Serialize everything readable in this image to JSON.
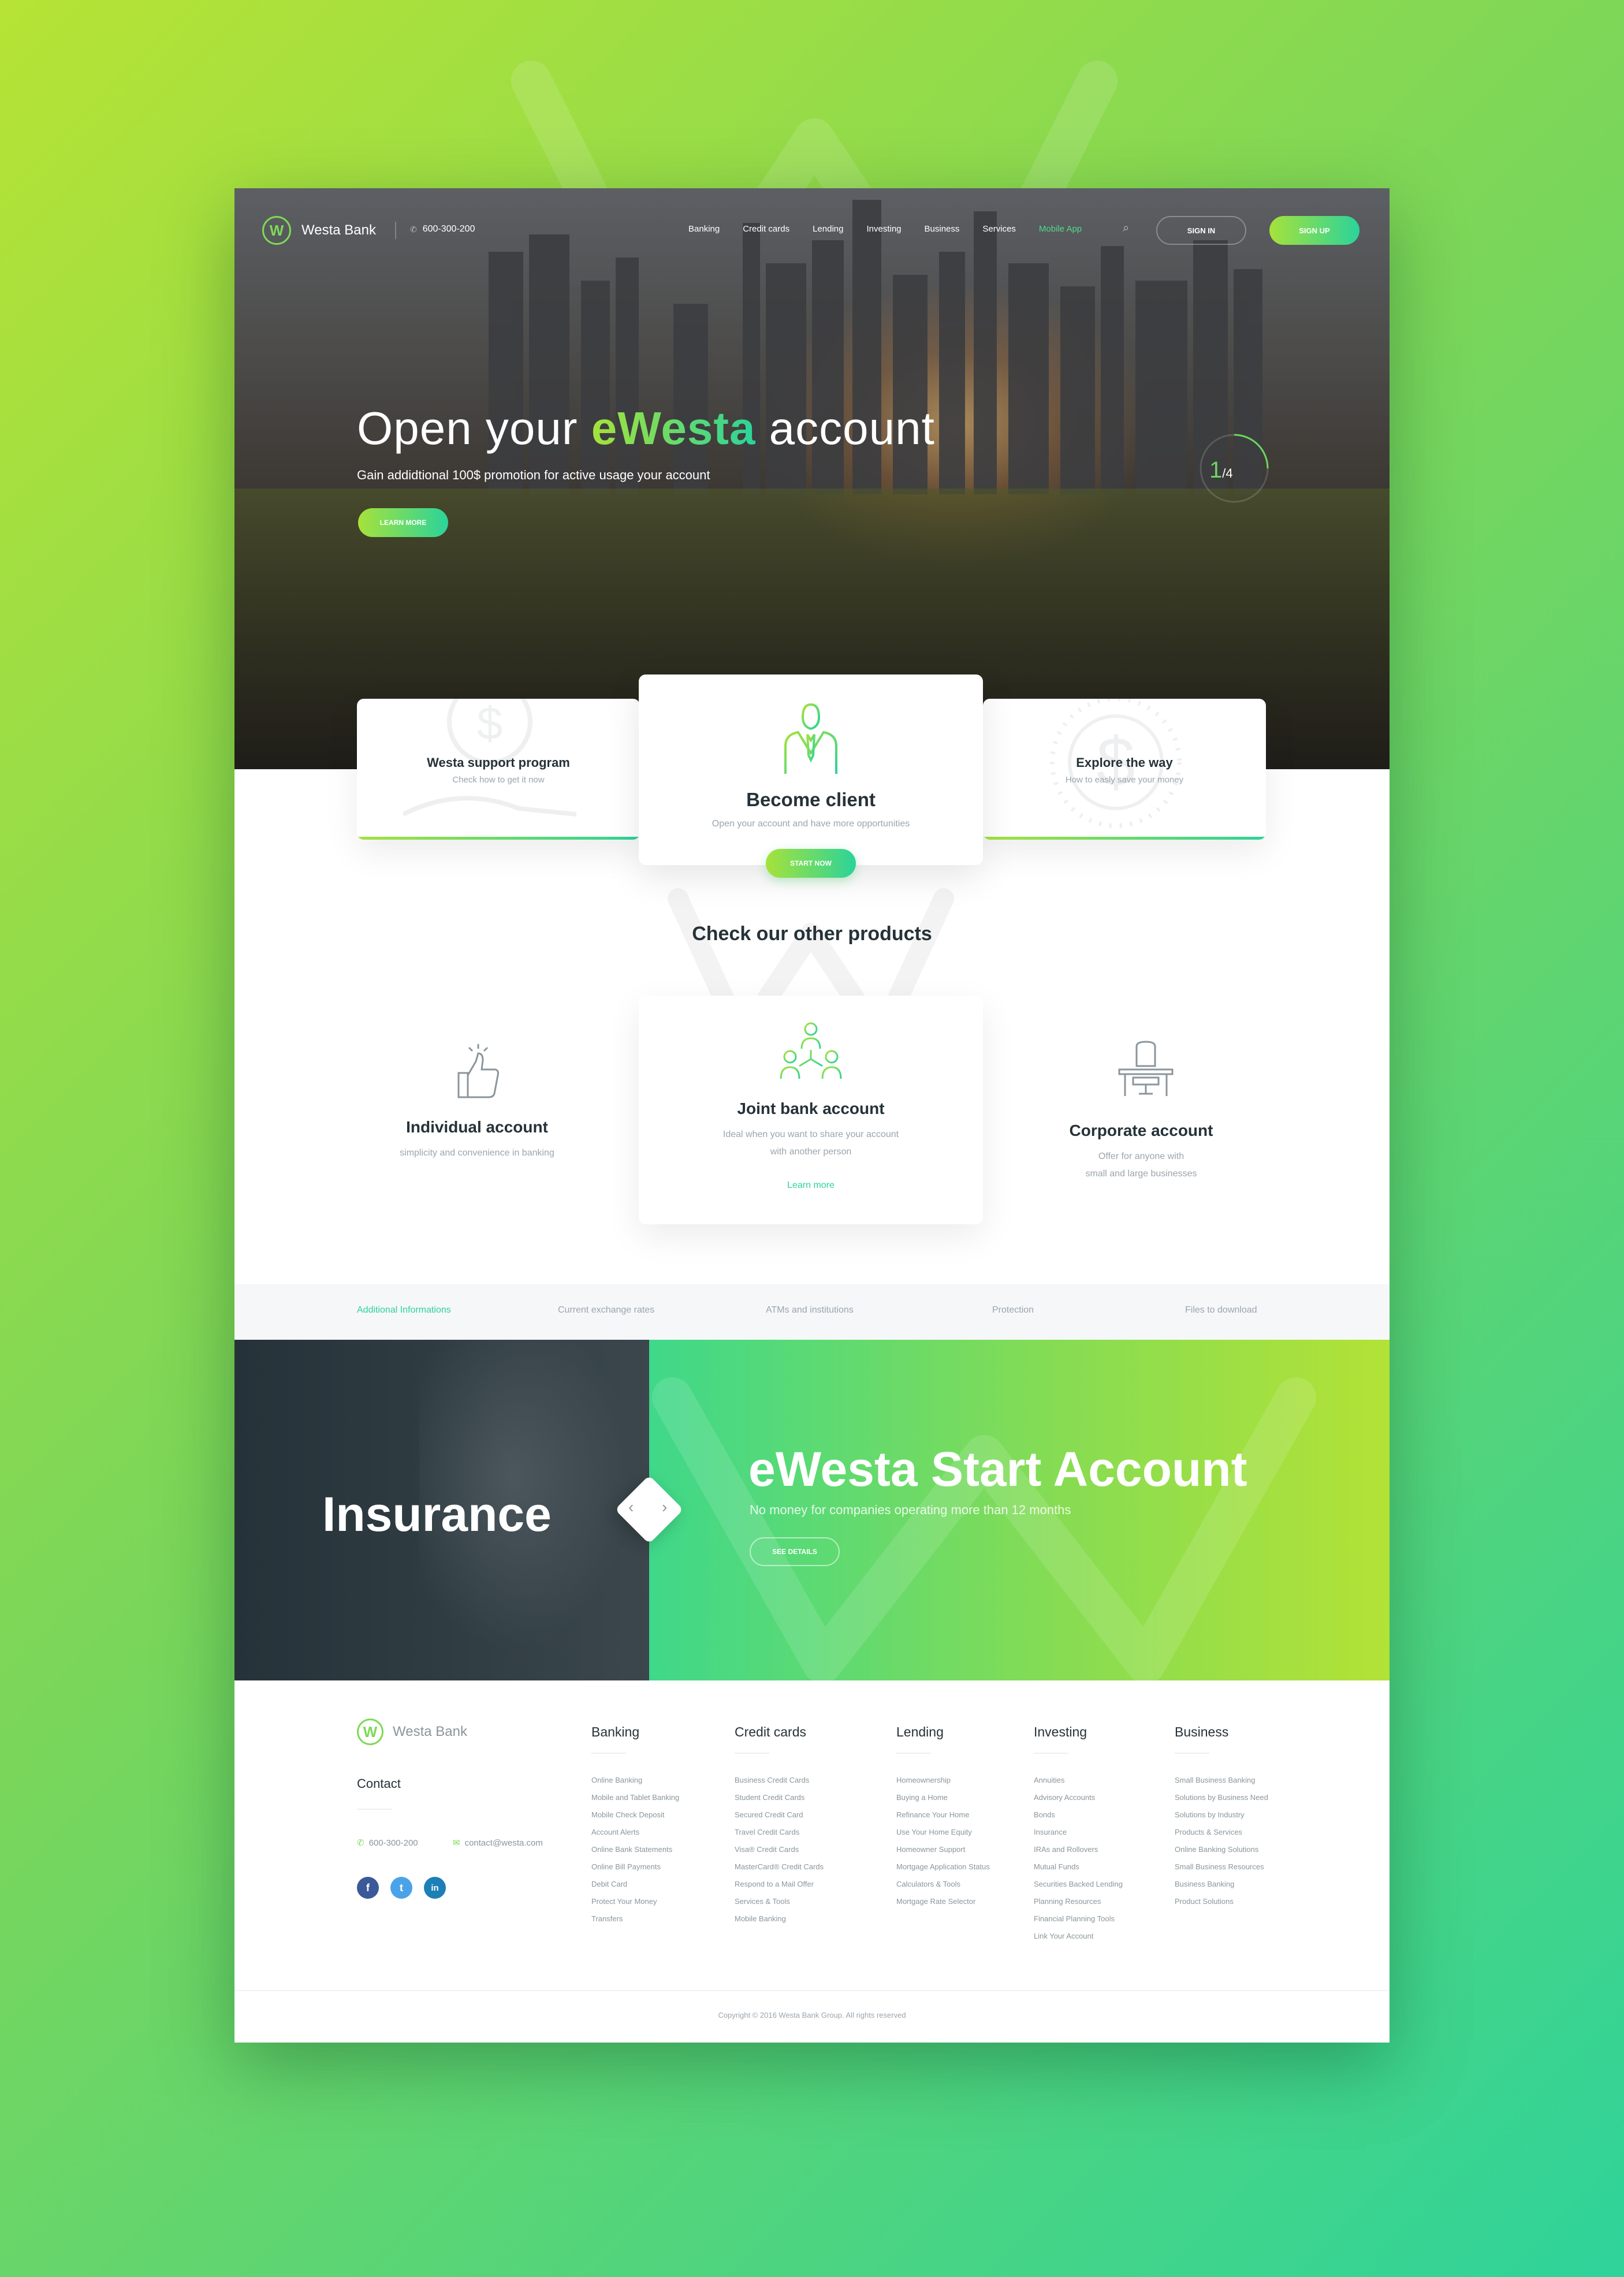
{
  "brand": {
    "name": "Westa Bank",
    "logo_letter": "W",
    "accent": "#2bd39a",
    "accent2": "#a6e23b"
  },
  "header": {
    "phone": "600-300-200",
    "menu": [
      "Banking",
      "Credit cards",
      "Lending",
      "Investing",
      "Business",
      "Services",
      "Mobile App"
    ],
    "active_menu": "Mobile App",
    "signin_label": "SIGN IN",
    "signup_label": "SIGN UP"
  },
  "hero": {
    "title_pre": "Open your ",
    "title_accent": "eWesta",
    "title_post": " account",
    "subtitle": "Gain addidtional 100$ promotion for active usage your account",
    "button_label": "LEARN MORE",
    "slide_current": "1",
    "slide_total": "/4",
    "slide_progress": 0.25
  },
  "features": {
    "left": {
      "title": "Westa support program",
      "subtitle": "Check how to get it now"
    },
    "center": {
      "title": "Become client",
      "subtitle": "Open your account and have more opportunities",
      "button_label": "START NOW"
    },
    "right": {
      "title": "Explore the way",
      "subtitle": "How to easly save your money"
    }
  },
  "products": {
    "title": "Check our other products",
    "left": {
      "title": "Individual account",
      "subtitle": "simplicity and convenience in banking"
    },
    "center": {
      "title": "Joint bank account",
      "subtitle_line1": "Ideal when you want to share your account",
      "subtitle_line2": "with another person",
      "link": "Learn more"
    },
    "right": {
      "title": "Corporate account",
      "subtitle_line1": "Offer for anyone with",
      "subtitle_line2": "small and large businesses"
    }
  },
  "tabs": [
    "Additional Informations",
    "Current exchange rates",
    "ATMs and institutions",
    "Protection",
    "Files to download"
  ],
  "insurance": {
    "title": "Insurance"
  },
  "promo": {
    "title": "eWesta Start Account",
    "subtitle": "No money for companies operating more than 12 months",
    "button_label": "SEE DETAILS"
  },
  "footer": {
    "brand": "Westa Bank",
    "contact_title": "Contact",
    "phone": "600-300-200",
    "email": "contact@westa.com",
    "social": [
      "f",
      "t",
      "in"
    ],
    "columns": [
      {
        "title": "Banking",
        "items": [
          "Online Banking",
          "Mobile and Tablet Banking",
          "Mobile Check Deposit",
          "Account Alerts",
          "Online Bank Statements",
          "Online Bill Payments",
          "Debit Card",
          "Protect Your Money",
          "Transfers"
        ]
      },
      {
        "title": "Credit cards",
        "items": [
          "Business Credit Cards",
          "Student Credit Cards",
          "Secured Credit Card",
          "Travel Credit Cards",
          "Visa® Credit Cards",
          "MasterCard® Credit Cards",
          "Respond to a Mail Offer",
          "Services & Tools",
          "Mobile Banking"
        ]
      },
      {
        "title": "Lending",
        "items": [
          "Homeownership",
          "Buying a Home",
          "Refinance Your Home",
          "Use Your Home Equity",
          "Homeowner Support",
          "Mortgage Application Status",
          "Calculators & Tools",
          "Mortgage Rate Selector"
        ]
      },
      {
        "title": "Investing",
        "items": [
          "Annuities",
          "Advisory Accounts",
          "Bonds",
          "Insurance",
          "IRAs and Rollovers",
          "Mutual Funds",
          "Securities Backed Lending",
          "Planning Resources",
          "Financial Planning Tools",
          "Link Your Account"
        ]
      },
      {
        "title": "Business",
        "items": [
          "Small Business Banking",
          "Solutions by Business Need",
          "Solutions by Industry",
          "Products & Services",
          "Online Banking Solutions",
          "Small Business Resources",
          "Business Banking",
          "Product Solutions"
        ]
      }
    ],
    "copyright": "Copyright © 2016 Westa Bank Group. All rights reserved"
  }
}
